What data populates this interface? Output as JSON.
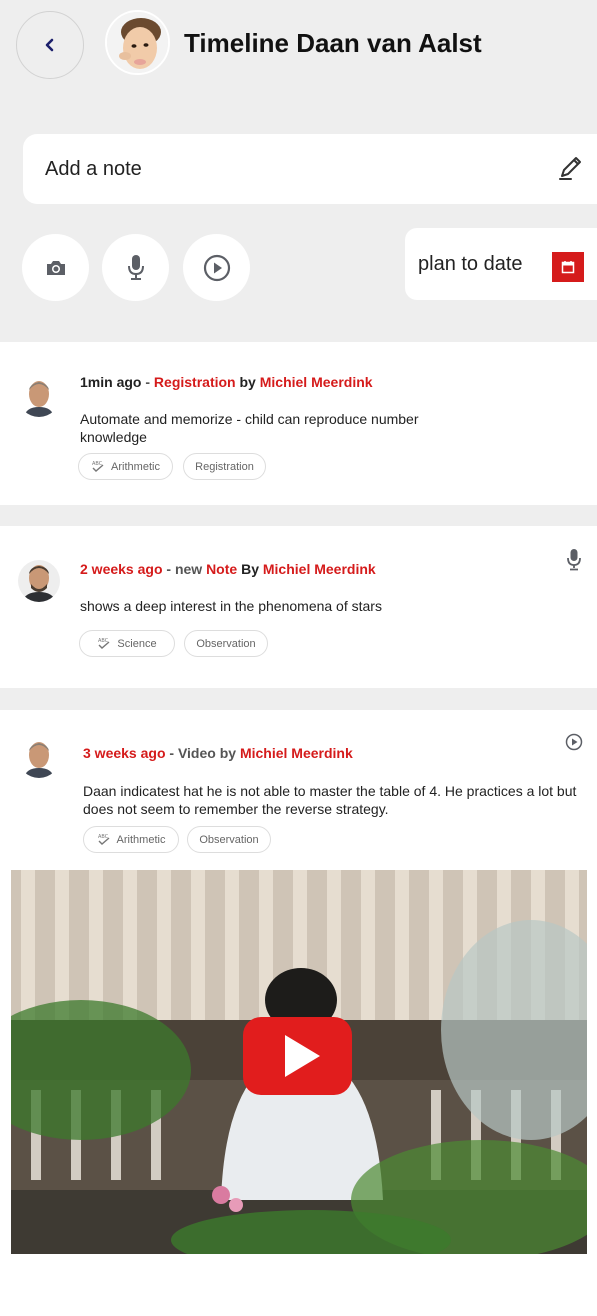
{
  "header": {
    "title": "Timeline Daan van Aalst",
    "back_icon": "chevron-left-icon"
  },
  "composer": {
    "note_placeholder": "Add a note",
    "note_icon": "pencil-icon",
    "actions": [
      "camera-icon",
      "microphone-icon",
      "play-icon"
    ],
    "plan_label": "plan to date",
    "plan_icon": "calendar-icon"
  },
  "colors": {
    "accent": "#d51b1b",
    "background": "#eeeeee",
    "card": "#ffffff"
  },
  "timeline": [
    {
      "time": "1min ago",
      "sep1": " - ",
      "kind": "Registration",
      "by": " by ",
      "author": "Michiel Meerdink",
      "text": "Automate and memorize - child can reproduce number knowledge",
      "tags": [
        "Arithmetic",
        "Registration"
      ]
    },
    {
      "time": "2 weeks ago",
      "sep1": " -  new ",
      "kind": "Note",
      "by": " By ",
      "author": "Michiel Meerdink",
      "text": "shows a deep interest in the phenomena of stars",
      "tags": [
        "Science",
        "Observation"
      ],
      "icon": "microphone-icon"
    },
    {
      "time": "3 weeks ago",
      "sep1": " - Video by ",
      "author": "Michiel Meerdink",
      "text": "Daan indicatest hat he is not able to master the table of 4. He practices a lot but does not seem to remember the reverse strategy.",
      "tags": [
        "Arithmetic",
        "Observation"
      ],
      "icon": "play-circle-icon",
      "video": "youtube-play-icon"
    }
  ]
}
